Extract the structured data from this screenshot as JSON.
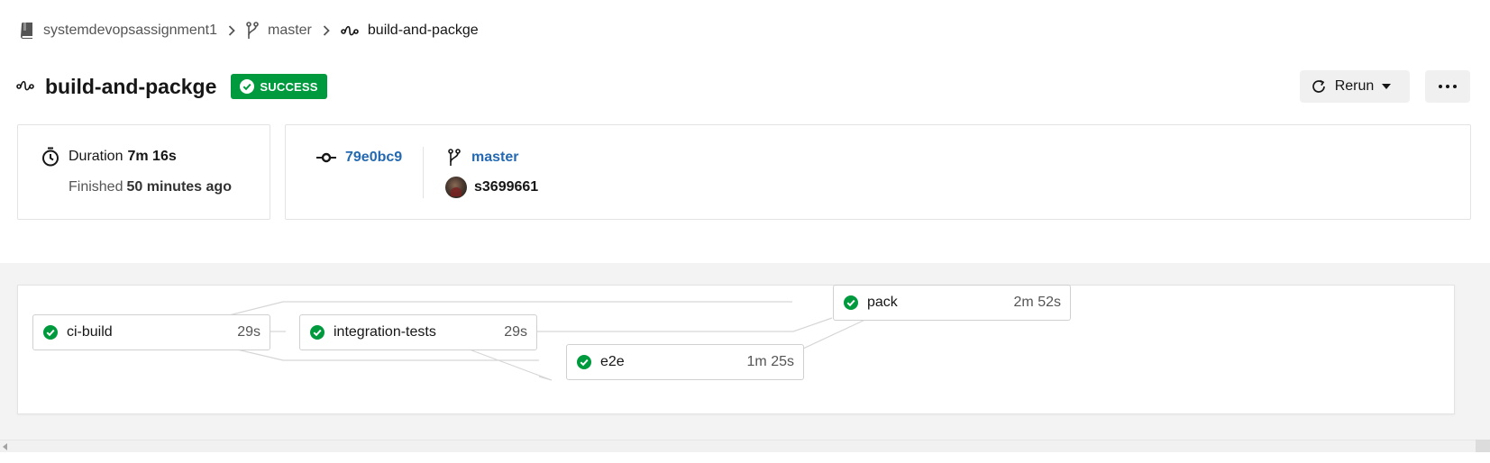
{
  "breadcrumb": {
    "project": "systemdevopsassignment1",
    "branch": "master",
    "workflow": "build-and-packge"
  },
  "header": {
    "title": "build-and-packge",
    "status": "SUCCESS",
    "rerun_label": "Rerun"
  },
  "duration_card": {
    "duration_label": "Duration",
    "duration_value": "7m 16s",
    "finished_label": "Finished",
    "finished_value": "50 minutes ago"
  },
  "commit_card": {
    "commit_hash": "79e0bc9",
    "branch": "master",
    "user": "s3699661"
  },
  "jobs": [
    {
      "name": "ci-build",
      "time": "29s"
    },
    {
      "name": "integration-tests",
      "time": "29s"
    },
    {
      "name": "e2e",
      "time": "1m 25s"
    },
    {
      "name": "pack",
      "time": "2m 52s"
    }
  ],
  "colors": {
    "success": "#009a3e",
    "link": "#2469b1",
    "button_bg": "#f0f0f0"
  },
  "icons": [
    "repo-icon",
    "branch-icon",
    "workflow-icon",
    "check-circle-icon",
    "rerun-icon",
    "caret-down-icon",
    "ellipsis-icon",
    "stopwatch-icon",
    "commit-icon"
  ]
}
